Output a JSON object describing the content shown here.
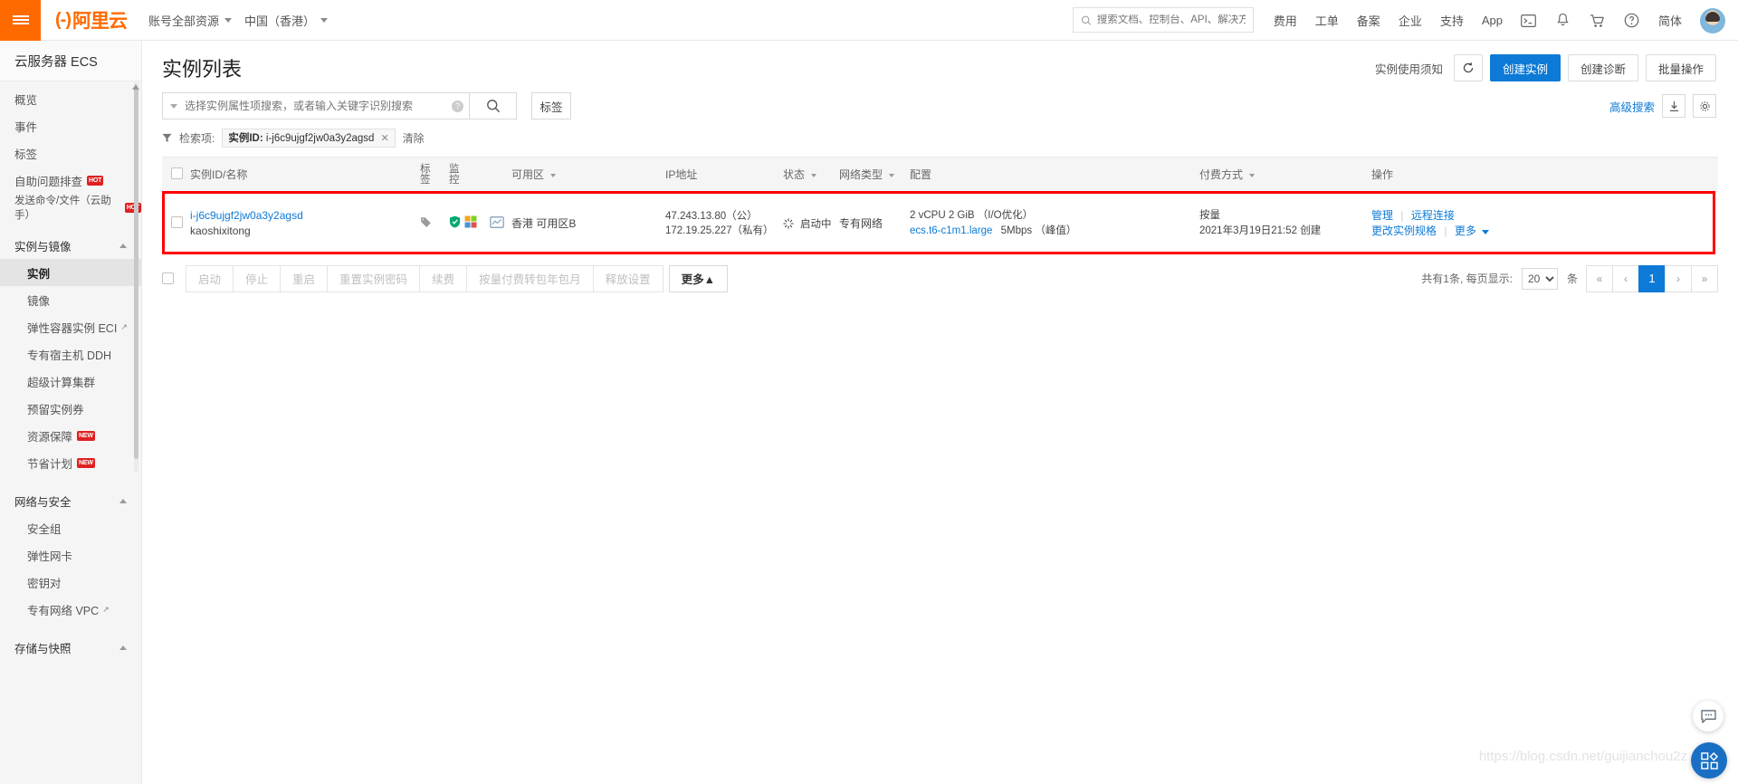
{
  "topbar": {
    "menu_icon": "hamburger-icon",
    "logo_text": "阿里云",
    "resource_scope": "账号全部资源",
    "region": "中国（香港）",
    "search_placeholder": "搜索文档、控制台、API、解决方案和资源",
    "nav": [
      {
        "label": "费用"
      },
      {
        "label": "工单"
      },
      {
        "label": "备案"
      },
      {
        "label": "企业"
      },
      {
        "label": "支持"
      },
      {
        "label": "App"
      }
    ],
    "icons": [
      "terminal-icon",
      "bell-icon",
      "cart-icon",
      "help-icon"
    ],
    "language": "简体"
  },
  "sidebar": {
    "title": "云服务器 ECS",
    "items": [
      {
        "label": "概览",
        "type": "item"
      },
      {
        "label": "事件",
        "type": "item"
      },
      {
        "label": "标签",
        "type": "item"
      },
      {
        "label": "自助问题排查",
        "type": "item",
        "badge": "HOT"
      },
      {
        "label": "发送命令/文件（云助手）",
        "type": "item",
        "badge": "HOT"
      },
      {
        "label": "实例与镜像",
        "type": "group"
      },
      {
        "label": "实例",
        "type": "sub",
        "active": true
      },
      {
        "label": "镜像",
        "type": "sub"
      },
      {
        "label": "弹性容器实例 ECI",
        "type": "sub",
        "external": true
      },
      {
        "label": "专有宿主机 DDH",
        "type": "sub"
      },
      {
        "label": "超级计算集群",
        "type": "sub"
      },
      {
        "label": "预留实例券",
        "type": "sub"
      },
      {
        "label": "资源保障",
        "type": "sub",
        "badge": "NEW"
      },
      {
        "label": "节省计划",
        "type": "sub",
        "badge": "NEW"
      },
      {
        "label": "网络与安全",
        "type": "group"
      },
      {
        "label": "安全组",
        "type": "sub"
      },
      {
        "label": "弹性网卡",
        "type": "sub"
      },
      {
        "label": "密钥对",
        "type": "sub"
      },
      {
        "label": "专有网络 VPC",
        "type": "sub",
        "external": true
      },
      {
        "label": "存储与快照",
        "type": "group"
      }
    ]
  },
  "page": {
    "title": "实例列表",
    "notice_link": "实例使用须知",
    "refresh_icon": "refresh-icon",
    "create_instance": "创建实例",
    "create_diagnosis": "创建诊断",
    "batch_operation": "批量操作"
  },
  "search": {
    "placeholder": "选择实例属性项搜索，或者输入关键字识别搜索",
    "value": "",
    "search_icon": "search-icon",
    "help_icon": "question-icon",
    "tag_button": "标签",
    "advanced_link": "高级搜索",
    "download_icon": "download-icon",
    "settings_icon": "gear-icon"
  },
  "filter": {
    "label": "检索项:",
    "chip_key": "实例ID:",
    "chip_value": "i-j6c9ujgf2jw0a3y2agsd",
    "chip_close": "✕",
    "clear": "清除"
  },
  "table": {
    "headers": {
      "instance": "实例ID/名称",
      "tag_l1": "标",
      "tag_l2": "签",
      "monitor_l1": "监",
      "monitor_l2": "控",
      "zone": "可用区",
      "ip": "IP地址",
      "status": "状态",
      "network_type": "网络类型",
      "config": "配置",
      "payment": "付费方式",
      "actions": "操作"
    },
    "rows": [
      {
        "instance_id": "i-j6c9ujgf2jw0a3y2agsd",
        "instance_name": "kaoshixitong",
        "zone": "香港 可用区B",
        "ip_public": "47.243.13.80（公）",
        "ip_private": "172.19.25.227（私有）",
        "status": "启动中",
        "network_type": "专有网络",
        "config_line1": "2 vCPU 2 GiB （I/O优化）",
        "config_type": "ecs.t6-c1m1.large",
        "config_bw": "5Mbps （峰值）",
        "payment": "按量",
        "created": "2021年3月19日21:52 创建",
        "actions": [
          "管理",
          "远程连接",
          "更改实例规格",
          "更多"
        ]
      }
    ]
  },
  "bottom": {
    "buttons": [
      {
        "label": "启动",
        "enabled": false
      },
      {
        "label": "停止",
        "enabled": false
      },
      {
        "label": "重启",
        "enabled": false
      },
      {
        "label": "重置实例密码",
        "enabled": false
      },
      {
        "label": "续费",
        "enabled": false
      },
      {
        "label": "按量付费转包年包月",
        "enabled": false
      },
      {
        "label": "释放设置",
        "enabled": false
      },
      {
        "label": "更多▲",
        "enabled": true
      }
    ],
    "total_text": "共有1条, 每页显示:",
    "page_size": "20",
    "unit": "条",
    "pages": [
      "«",
      "‹",
      "1",
      "›",
      "»"
    ],
    "current_page": "1"
  },
  "floating": {
    "chat_icon": "chat-icon",
    "watermark": "https://blog.csdn.net/guijianchou2z"
  },
  "colors": {
    "brand_orange": "#ff6a00",
    "primary_blue": "#0c7ad6",
    "highlight_red": "#ff0000",
    "badge_red": "#e02020"
  }
}
